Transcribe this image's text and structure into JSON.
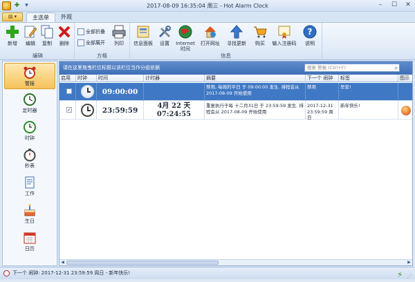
{
  "window": {
    "title": "2017-08-09 16:35:04 周三 - Hot Alarm Clock",
    "menu_button": "▾"
  },
  "tabs": [
    {
      "label": "主选单",
      "active": true
    },
    {
      "label": "外观",
      "active": false
    }
  ],
  "ribbon": {
    "groups": {
      "edit": {
        "label": "编辑",
        "buttons": [
          "新增",
          "编辑",
          "复制",
          "删除"
        ]
      },
      "scheme": {
        "label": "方格",
        "collapse_all": "全部折叠",
        "expand_all": "全部展开",
        "print": "列印"
      },
      "info": {
        "label": "信息",
        "buttons": [
          "信息面板",
          "设置",
          "Internet\n时间",
          "打开网址",
          "寻找更新",
          "购买",
          "输入注册码",
          "说明"
        ]
      }
    }
  },
  "nav": {
    "items": [
      {
        "label": "警报",
        "icon": "alarm-clock-icon",
        "active": true
      },
      {
        "label": "定时器",
        "icon": "timer-icon",
        "active": false
      },
      {
        "label": "时钟",
        "icon": "clock-icon",
        "active": false
      },
      {
        "label": "秒表",
        "icon": "stopwatch-icon",
        "active": false
      },
      {
        "label": "工作",
        "icon": "task-icon",
        "active": false
      },
      {
        "label": "生日",
        "icon": "birthday-cake-icon",
        "active": false
      },
      {
        "label": "日历",
        "icon": "calendar-icon",
        "active": false
      }
    ]
  },
  "grid": {
    "group_hint": "请在这里拖曳栏位标题以该栏位当作分组依据",
    "search_placeholder": "搜索 警报 (Ctrl+F)",
    "columns": [
      "启用",
      "时钟",
      "时间",
      "计时器",
      "摘要",
      "下一个 闹钟",
      "标签",
      "图示"
    ],
    "rows": [
      {
        "enabled": false,
        "time": "09:00:00",
        "timer": "",
        "summary_line1": "禁用, 每周的平日 于 09:00:00 发生. 排程会从",
        "summary_line2": "2017-08-09 开始使用",
        "next_alarm": "禁用",
        "label": "早安!",
        "selected": true
      },
      {
        "enabled": true,
        "time": "23:59:59",
        "timer_line1": "4月  22 天",
        "timer_line2": "07:24:55",
        "summary_line1": "重复执行于每 十二月31日 于 23:59:59 发生. 排",
        "summary_line2": "程会从 2017-08-09 开始使用",
        "next_alarm_line1": "2017-12-31",
        "next_alarm_line2": "23:59:59 周日",
        "label": "新年快乐!",
        "selected": false
      }
    ]
  },
  "status": {
    "text": "下一个 闹钟: 2017-12-31 23:59:59 周日 - 新年快乐!"
  }
}
